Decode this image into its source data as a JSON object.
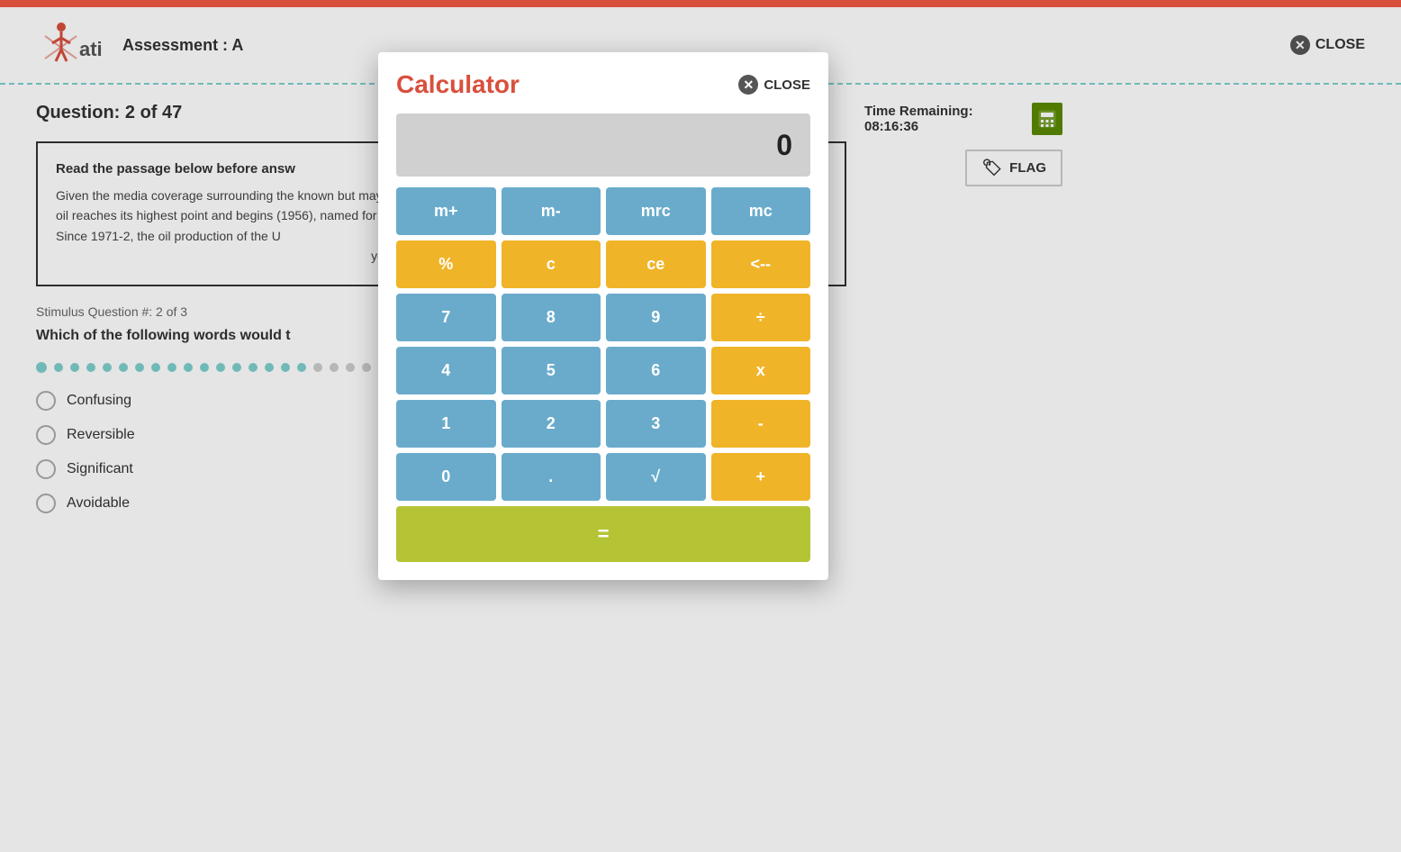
{
  "app": {
    "top_bar_color": "#d94f3d"
  },
  "header": {
    "logo_text": "ati",
    "assessment_label": "Assessment : A",
    "close_label": "CLOSE"
  },
  "question": {
    "label": "Question: 2 of 47",
    "passage_title": "Read the passage below before answ",
    "passage_text": "Given the media coverage surrounding... known but may become just as crucial i... oil reaches its highest point and begins... (1956), named for the scientist who for... Since 1971-2, the oil production of the U...",
    "passage_text_full": "Given the media coverage surrounding the known but may become just as crucial i oil reaches its highest point and begins (1956), named for the scientist who for Since 1971-2, the oil production of the U",
    "passage_suffix_right": "well n of year.",
    "stimulus_info": "Stimulus Question #: 2 of 3",
    "question_text": "Which of the following words would t",
    "answers": [
      {
        "label": "Confusing"
      },
      {
        "label": "Reversible"
      },
      {
        "label": "Significant"
      },
      {
        "label": "Avoidable"
      }
    ]
  },
  "sidebar": {
    "time_remaining_label": "Time Remaining:",
    "time_value": "08:16:36",
    "flag_label": "FLAG"
  },
  "calculator": {
    "title": "Calculator",
    "close_label": "CLOSE",
    "display_value": "0",
    "buttons": [
      {
        "label": "m+",
        "type": "blue"
      },
      {
        "label": "m-",
        "type": "blue"
      },
      {
        "label": "mrc",
        "type": "blue"
      },
      {
        "label": "mc",
        "type": "blue"
      },
      {
        "label": "%",
        "type": "yellow"
      },
      {
        "label": "c",
        "type": "yellow"
      },
      {
        "label": "ce",
        "type": "yellow"
      },
      {
        "label": "<--",
        "type": "yellow"
      },
      {
        "label": "7",
        "type": "blue"
      },
      {
        "label": "8",
        "type": "blue"
      },
      {
        "label": "9",
        "type": "blue"
      },
      {
        "label": "÷",
        "type": "yellow"
      },
      {
        "label": "4",
        "type": "blue"
      },
      {
        "label": "5",
        "type": "blue"
      },
      {
        "label": "6",
        "type": "blue"
      },
      {
        "label": "x",
        "type": "yellow"
      },
      {
        "label": "1",
        "type": "blue"
      },
      {
        "label": "2",
        "type": "blue"
      },
      {
        "label": "3",
        "type": "blue"
      },
      {
        "label": "-",
        "type": "yellow"
      },
      {
        "label": "0",
        "type": "blue"
      },
      {
        "label": ".",
        "type": "blue"
      },
      {
        "label": "√",
        "type": "blue"
      },
      {
        "label": "+",
        "type": "yellow"
      },
      {
        "label": "=",
        "type": "equals"
      }
    ]
  },
  "progress_dots": {
    "total": 47,
    "current": 2
  }
}
